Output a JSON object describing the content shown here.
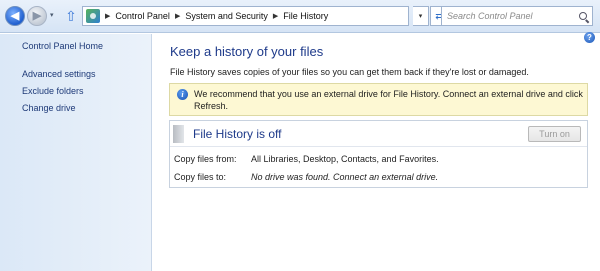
{
  "nav": {
    "back_glyph": "◀",
    "forward_glyph": "▶",
    "recent_glyph": "▾",
    "up_glyph": "⇧",
    "breadcrumb_sep": "▶",
    "address_dropdown_glyph": "▾",
    "refresh_glyph": "⇄",
    "breadcrumbs": [
      "Control Panel",
      "System and Security",
      "File History"
    ]
  },
  "search": {
    "placeholder": "Search Control Panel"
  },
  "sidebar": {
    "items": [
      {
        "label": "Control Panel Home"
      },
      {
        "label": "Advanced settings"
      },
      {
        "label": "Exclude folders"
      },
      {
        "label": "Change drive"
      }
    ]
  },
  "main": {
    "help_glyph": "?",
    "heading": "Keep a history of your files",
    "description": "File History saves copies of your files so you can get them back if they're lost or damaged.",
    "banner": {
      "icon_glyph": "i",
      "text": "We recommend that you use an external drive for File History. Connect an external drive and click Refresh."
    },
    "status": {
      "title": "File History is off",
      "button_label": "Turn on",
      "rows": [
        {
          "label": "Copy files from:",
          "value": "All Libraries, Desktop, Contacts, and Favorites."
        },
        {
          "label": "Copy files to:",
          "value": "No drive was found. Connect an external drive."
        }
      ]
    }
  },
  "colors": {
    "link": "#1e3a78",
    "heading": "#1e3a8a",
    "banner_bg": "#fdf8d3",
    "sidebar_bg": "#dbe8f7"
  },
  "icons": [
    "back-arrow-icon",
    "forward-arrow-icon",
    "up-arrow-icon",
    "control-panel-icon",
    "refresh-icon",
    "search-icon",
    "help-icon",
    "info-icon"
  ]
}
